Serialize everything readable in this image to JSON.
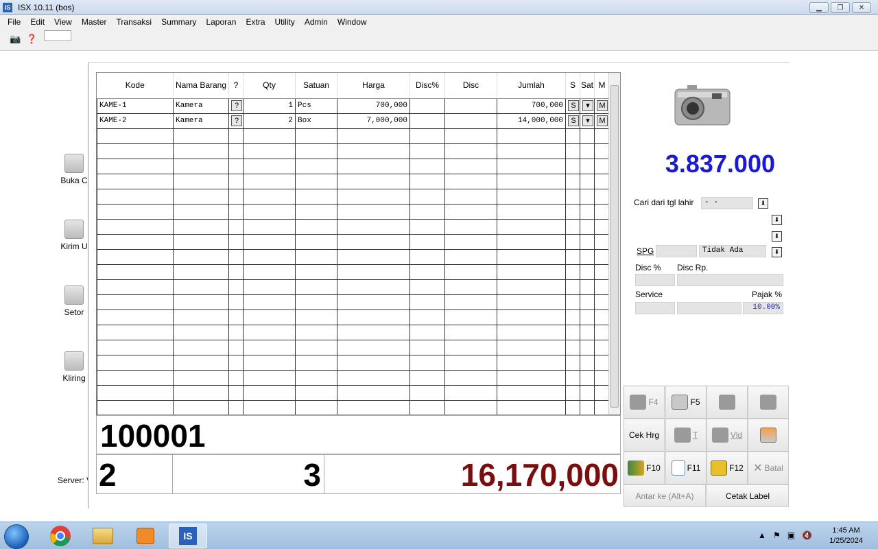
{
  "window": {
    "title": "ISX 10.11 (bos)",
    "app_icon": "IS"
  },
  "menu": [
    "File",
    "Edit",
    "View",
    "Master",
    "Transaksi",
    "Summary",
    "Laporan",
    "Extra",
    "Utility",
    "Admin",
    "Window"
  ],
  "desktop_icons": [
    "Buka C",
    "Kirim U",
    "Setor",
    "Kliring"
  ],
  "server_label": "Server: V",
  "grid": {
    "headers": [
      "Kode",
      "Nama Barang",
      "?",
      "Qty",
      "Satuan",
      "Harga",
      "Disc%",
      "Disc",
      "Jumlah",
      "S",
      "Sat",
      "M"
    ],
    "rows": [
      {
        "kode": "KAME-1",
        "nama": "Kamera",
        "q": "?",
        "qty": "1",
        "satuan": "Pcs",
        "harga": "700,000",
        "discp": "",
        "disc": "",
        "jumlah": "700,000",
        "s": "S",
        "m": "M"
      },
      {
        "kode": "KAME-2",
        "nama": "Kamera",
        "q": "?",
        "qty": "2",
        "satuan": "Box",
        "harga": "7,000,000",
        "discp": "",
        "disc": "",
        "jumlah": "14,000,000",
        "s": "S",
        "m": "M"
      }
    ],
    "empty_rows": 19
  },
  "barcode": "100001",
  "totals": {
    "items": "2",
    "qty": "3",
    "amount": "16,170,000"
  },
  "big_total": "3.837.000",
  "form": {
    "birth_search_label": "Cari dari tgl lahir",
    "birth_search_value": " -  -",
    "spg_label": "SPG",
    "spg_value": "Tidak Ada",
    "disc_pct_label": "Disc %",
    "disc_rp_label": "Disc Rp.",
    "service_label": "Service",
    "tax_label": "Pajak %",
    "tax_value": "10.00%"
  },
  "fbuttons": {
    "f4": "F4",
    "f5": "F5",
    "cek_hrg": "Cek Hrg",
    "t": "T",
    "vld": "Vld",
    "f10": "F10",
    "f11": "F11",
    "f12": "F12",
    "batal": "Batal",
    "antar": "Antar ke (Alt+A)",
    "cetak_label": "Cetak Label"
  },
  "colors": {
    "big_total": "#1a1ad0",
    "amount": "#7a0e0e"
  },
  "clock": {
    "time": "1:45 AM",
    "date": "1/25/2024"
  }
}
